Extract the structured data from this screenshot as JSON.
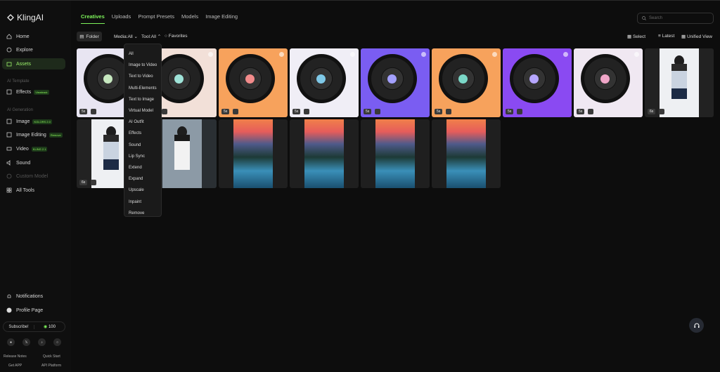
{
  "app": {
    "name": "KlingAI"
  },
  "sidebar": {
    "items": [
      {
        "label": "Home"
      },
      {
        "label": "Explore"
      },
      {
        "label": "Assets"
      }
    ],
    "section_template": "AI Template",
    "effects": {
      "label": "Effects",
      "tag": "Viewtrack"
    },
    "section_generation": "AI Generation",
    "gen": [
      {
        "label": "Image",
        "tag": "KOLORS 2.0"
      },
      {
        "label": "Image Editing",
        "tag": "Remove"
      },
      {
        "label": "Video",
        "tag": "KLING 2.1"
      },
      {
        "label": "Sound",
        "tag": ""
      },
      {
        "label": "Custom Model",
        "tag": ""
      },
      {
        "label": "All Tools",
        "tag": ""
      }
    ],
    "notifications": "Notifications",
    "profile": "Profile Page",
    "subscribe": "Subscribe!",
    "credits": "100",
    "footer": [
      "Release Notes",
      "Quick Start",
      "Get APP",
      "API Platform"
    ]
  },
  "tabs": [
    "Creatives",
    "Uploads",
    "Prompt Presets",
    "Models",
    "Image Editing"
  ],
  "search_placeholder": "Search",
  "toolbar": {
    "folder": "Folder",
    "media": "Media:All",
    "tool": "Tool:All",
    "favorites": "Favorites",
    "select": "Select",
    "latest": "Latest",
    "unified": "Unified View"
  },
  "dropdown": [
    "All",
    "Image to Video",
    "Text to Video",
    "Multi-Elements",
    "Text to Image",
    "Virtual Model",
    "AI Outfit",
    "Effects",
    "Sound",
    "Lip Sync",
    "Extend",
    "Expand",
    "Upscale",
    "Inpaint",
    "Remove"
  ],
  "tiles": [
    {
      "badge": "5s",
      "kind": "record",
      "bg": "#e8e5f2",
      "label": "#c7e8c0"
    },
    {
      "badge": "5s",
      "kind": "record",
      "bg": "#f2e0d8",
      "label": "#9fe3d8"
    },
    {
      "badge": "5s",
      "kind": "record",
      "bg": "#f7a25c",
      "label": "#f28b8b"
    },
    {
      "badge": "5s",
      "kind": "record",
      "bg": "#f0eef6",
      "label": "#7fc9e8"
    },
    {
      "badge": "5s",
      "kind": "record",
      "bg": "#7a5df2",
      "label": "#a3a0ff"
    },
    {
      "badge": "5s",
      "kind": "record",
      "bg": "#f7a25c",
      "label": "#7bd8c8"
    },
    {
      "badge": "5s",
      "kind": "record",
      "bg": "#8a4af2",
      "label": "#b6a6ff"
    },
    {
      "badge": "5s",
      "kind": "record",
      "bg": "#f0e8f2",
      "label": "#f0a6c8"
    },
    {
      "badge": "6s",
      "kind": "portrait"
    },
    {
      "badge": "6s",
      "kind": "portrait"
    },
    {
      "badge": "",
      "kind": "portrait-dark"
    },
    {
      "badge": "",
      "kind": "landscape"
    },
    {
      "badge": "",
      "kind": "landscape"
    },
    {
      "badge": "",
      "kind": "landscape"
    },
    {
      "badge": "",
      "kind": "landscape"
    }
  ]
}
